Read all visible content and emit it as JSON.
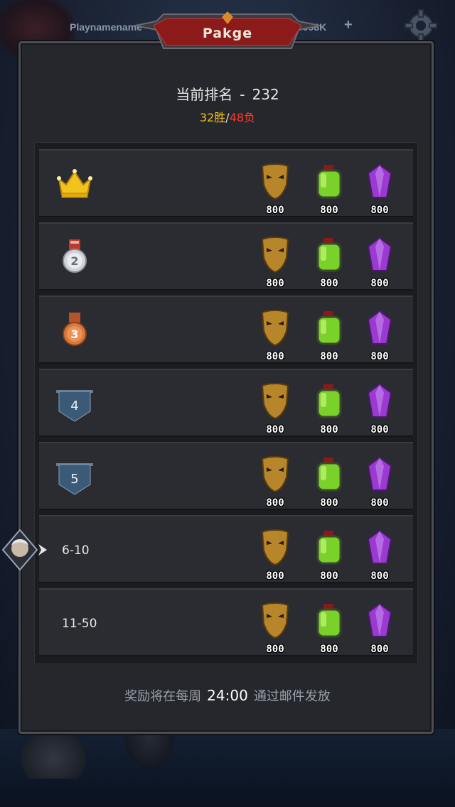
{
  "top_bar": {
    "player_name": "Playnamename",
    "currency": "9098K",
    "plus_label": "+",
    "settings_icon": "gear-icon"
  },
  "title": "Pakge",
  "rank_summary": {
    "label": "当前排名",
    "separator": "-",
    "rank": "232",
    "wins": "32胜",
    "slash": "/",
    "losses": "48负"
  },
  "reward_icons": [
    "mask-icon",
    "potion-icon",
    "crystal-icon"
  ],
  "rows": [
    {
      "rank_icon": "crown-icon",
      "rank_text": "",
      "rewards": [
        "800",
        "800",
        "800"
      ]
    },
    {
      "rank_icon": "silver-medal-icon",
      "rank_text": "",
      "badge_number": "2",
      "rewards": [
        "800",
        "800",
        "800"
      ]
    },
    {
      "rank_icon": "bronze-medal-icon",
      "rank_text": "",
      "badge_number": "3",
      "rewards": [
        "800",
        "800",
        "800"
      ]
    },
    {
      "rank_icon": "pennant-icon",
      "rank_text": "",
      "badge_number": "4",
      "rewards": [
        "800",
        "800",
        "800"
      ]
    },
    {
      "rank_icon": "pennant-icon",
      "rank_text": "",
      "badge_number": "5",
      "rewards": [
        "800",
        "800",
        "800"
      ]
    },
    {
      "rank_icon": "",
      "rank_text": "6-10",
      "rewards": [
        "800",
        "800",
        "800"
      ]
    },
    {
      "rank_icon": "",
      "rank_text": "11-50",
      "rewards": [
        "800",
        "800",
        "800"
      ]
    }
  ],
  "footer": {
    "prefix": "奖励将在每周",
    "time": "24:00",
    "suffix": "通过邮件发放"
  },
  "colors": {
    "win": "#f2c21d",
    "loss": "#ff3b2f",
    "title_banner": "#8b1a1a"
  }
}
